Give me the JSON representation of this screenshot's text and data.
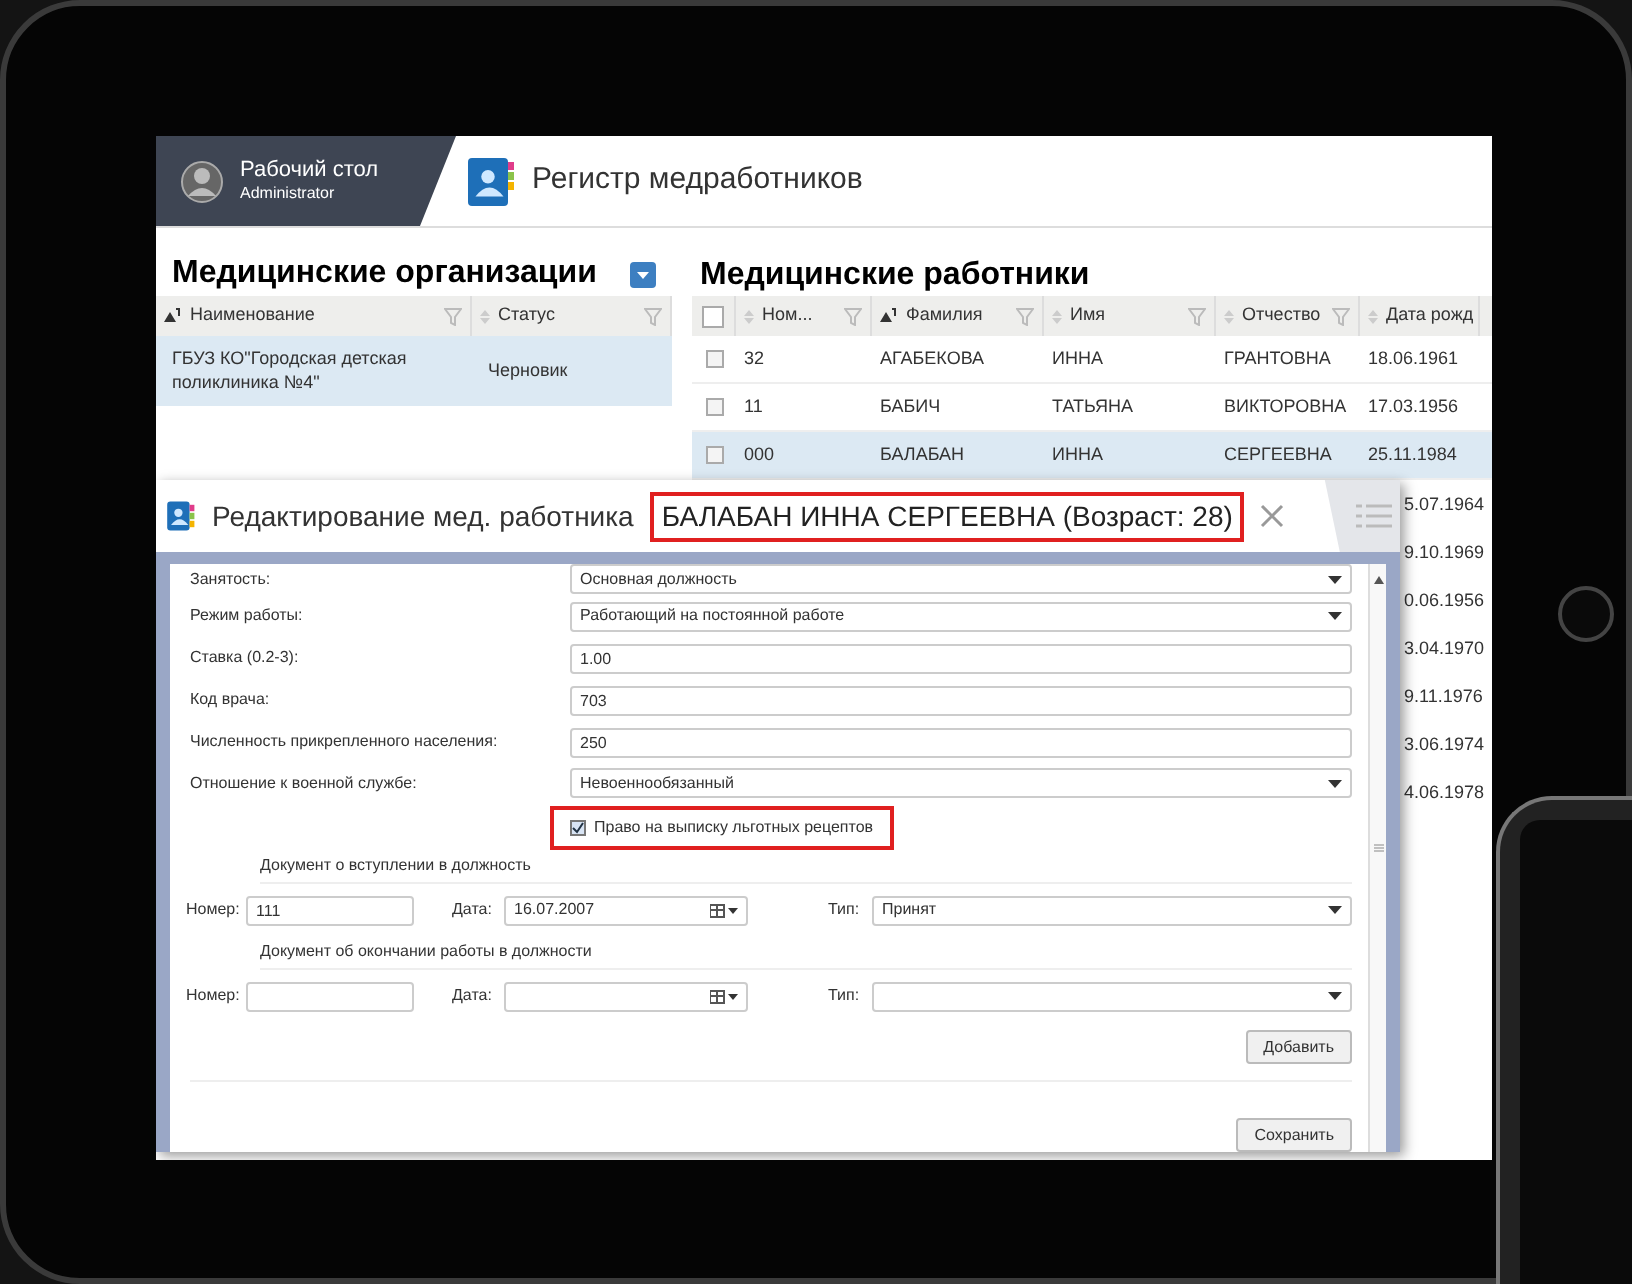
{
  "header": {
    "user_title": "Рабочий стол",
    "user_subtitle": "Administrator",
    "app_title": "Регистр медработников"
  },
  "organizations": {
    "title": "Медицинские организации",
    "columns": [
      {
        "label": "Наименование",
        "sorted": true,
        "filter": true
      },
      {
        "label": "Статус",
        "sorted": false,
        "filter": true
      }
    ],
    "rows": [
      {
        "cells": [
          "ГБУЗ КО\"Городская детская поликлиника №4\"",
          "Черновик"
        ],
        "selected": true
      }
    ]
  },
  "workers": {
    "title": "Медицинские работники",
    "select_all_checked": false,
    "columns": [
      {
        "label": "Ном...",
        "sorted": false,
        "filter": true
      },
      {
        "label": "Фамилия",
        "sorted": true,
        "filter": true
      },
      {
        "label": "Имя",
        "sorted": false,
        "filter": true
      },
      {
        "label": "Отчество",
        "sorted": false,
        "filter": true
      },
      {
        "label": "Дата рожд",
        "sorted": false
      }
    ],
    "rows": [
      {
        "checked": false,
        "selected": false,
        "cells": [
          "32",
          "АГАБЕКОВА",
          "ИННА",
          "ГРАНТОВНА",
          "18.06.1961"
        ]
      },
      {
        "checked": false,
        "selected": false,
        "cells": [
          "11",
          "БАБИЧ",
          "ТАТЬЯНА",
          "ВИКТОРОВНА",
          "17.03.1956"
        ]
      },
      {
        "checked": false,
        "selected": true,
        "cells": [
          "000",
          "БАЛАБАН",
          "ИННА",
          "СЕРГЕЕВНА",
          "25.11.1984"
        ]
      }
    ],
    "partly_hidden_dates": [
      "5.07.1964",
      "9.10.1969",
      "0.06.1956",
      "3.04.1970",
      "9.11.1976",
      "3.06.1974",
      "4.06.1978"
    ]
  },
  "dialog": {
    "title": "Редактирование мед. работника",
    "subject": "БАЛАБАН ИННА СЕРГЕЕВНА (Возраст: 28)",
    "subject_highlighted": true,
    "fields": [
      {
        "kind": "select",
        "label": "Занятость:",
        "value": "Основная должность"
      },
      {
        "kind": "select",
        "label": "Режим работы:",
        "value": "Работающий на постоянной работе"
      },
      {
        "kind": "text",
        "label": "Ставка (0.2-3):",
        "value": "1.00"
      },
      {
        "kind": "text",
        "label": "Код врача:",
        "value": "703"
      },
      {
        "kind": "text",
        "label": "Численность прикрепленного населения:",
        "value": "250"
      },
      {
        "kind": "select",
        "label": "Отношение к военной службе:",
        "value": "Невоеннообязанный"
      },
      {
        "kind": "checkbox",
        "label": "Право на выписку льготных рецептов",
        "checked": true,
        "highlighted": true
      }
    ],
    "documents": [
      {
        "title": "Документ о вступлении в должность",
        "number_label": "Номер:",
        "number": "111",
        "date_label": "Дата:",
        "date": "16.07.2007",
        "type_label": "Тип:",
        "type": "Принят"
      },
      {
        "title": "Документ об окончании работы в должности",
        "number_label": "Номер:",
        "date_label": "Дата:",
        "type_label": "Тип:"
      }
    ],
    "add_button": "Добавить",
    "save_button": "Сохранить"
  }
}
